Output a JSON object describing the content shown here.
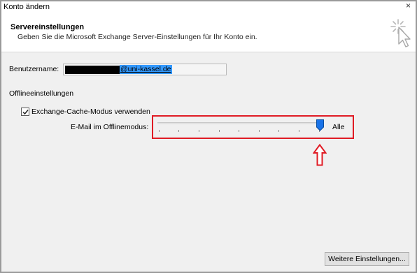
{
  "window": {
    "title": "Konto ändern",
    "close_glyph": "×"
  },
  "header": {
    "title": "Servereinstellungen",
    "subtitle": "Geben Sie die Microsoft Exchange Server-Einstellungen für Ihr Konto ein.",
    "icon": "cursor-click-icon"
  },
  "username": {
    "label": "Benutzername:",
    "value_domain": "@uni-kassel.de"
  },
  "offline": {
    "section_label": "Offlineeinstellungen",
    "cache_mode_label": "Exchange-Cache-Modus verwenden",
    "cache_mode_checked": true,
    "mail_offline_label": "E-Mail im Offlinemodus:",
    "slider_value_label": "Alle",
    "slider_level_fraction": 1.0
  },
  "annotation": {
    "highlight_color": "#e01b24",
    "arrow": "up-arrow"
  },
  "buttons": {
    "more_settings": "Weitere Einstellungen..."
  }
}
